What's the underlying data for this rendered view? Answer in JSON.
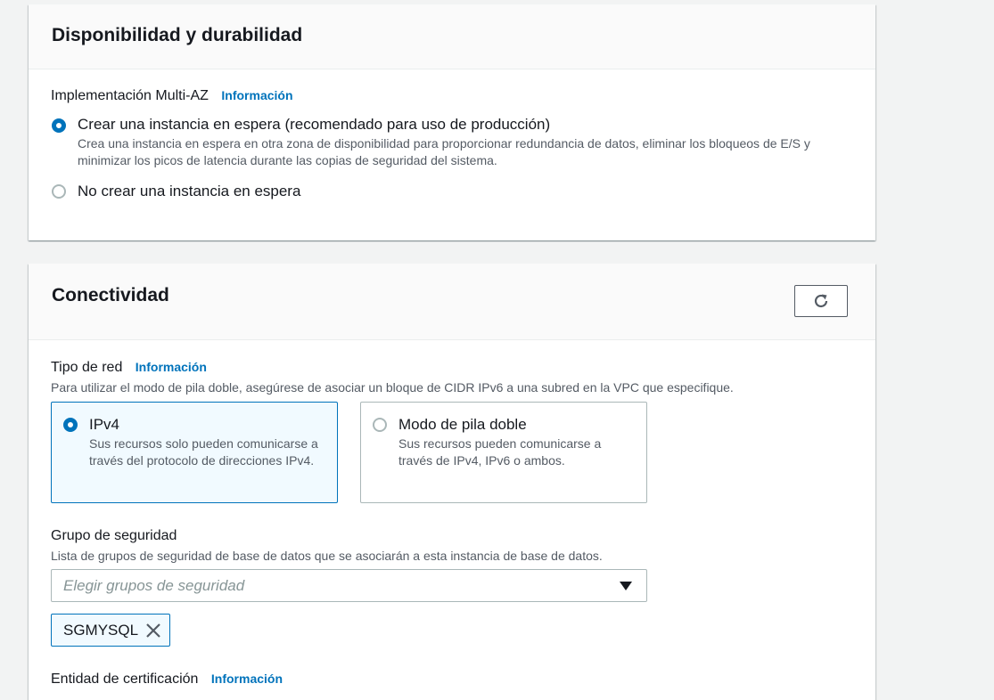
{
  "availability": {
    "title": "Disponibilidad y durabilidad",
    "multi_az_label": "Implementación Multi-AZ",
    "info_link": "Información",
    "options": [
      {
        "label": "Crear una instancia en espera (recomendado para uso de producción)",
        "description": "Crea una instancia en espera en otra zona de disponibilidad para proporcionar redundancia de datos, eliminar los bloqueos de E/S y minimizar los picos de latencia durante las copias de seguridad del sistema.",
        "selected": true
      },
      {
        "label": "No crear una instancia en espera",
        "selected": false
      }
    ]
  },
  "connectivity": {
    "title": "Conectividad",
    "refresh_icon": "refresh-icon",
    "network_type": {
      "label": "Tipo de red",
      "info_link": "Información",
      "description": "Para utilizar el modo de pila doble, asegúrese de asociar un bloque de CIDR IPv6 a una subred en la VPC que especifique.",
      "tiles": [
        {
          "label": "IPv4",
          "description": "Sus recursos solo pueden comunicarse a través del protocolo de direcciones IPv4.",
          "selected": true
        },
        {
          "label": "Modo de pila doble",
          "description": "Sus recursos pueden comunicarse a través de IPv4, IPv6 o ambos.",
          "selected": false
        }
      ]
    },
    "security_group": {
      "label": "Grupo de seguridad",
      "description": "Lista de grupos de seguridad de base de datos que se asociarán a esta instancia de base de datos.",
      "placeholder": "Elegir grupos de seguridad",
      "tokens": [
        "SGMYSQL"
      ]
    },
    "certificate_authority": {
      "label": "Entidad de certificación",
      "info_link": "Información"
    }
  },
  "colors": {
    "accent": "#0073bb",
    "page_background": "#f2f3f3",
    "header_background": "#fafafa",
    "secondary_text": "#545b64"
  }
}
